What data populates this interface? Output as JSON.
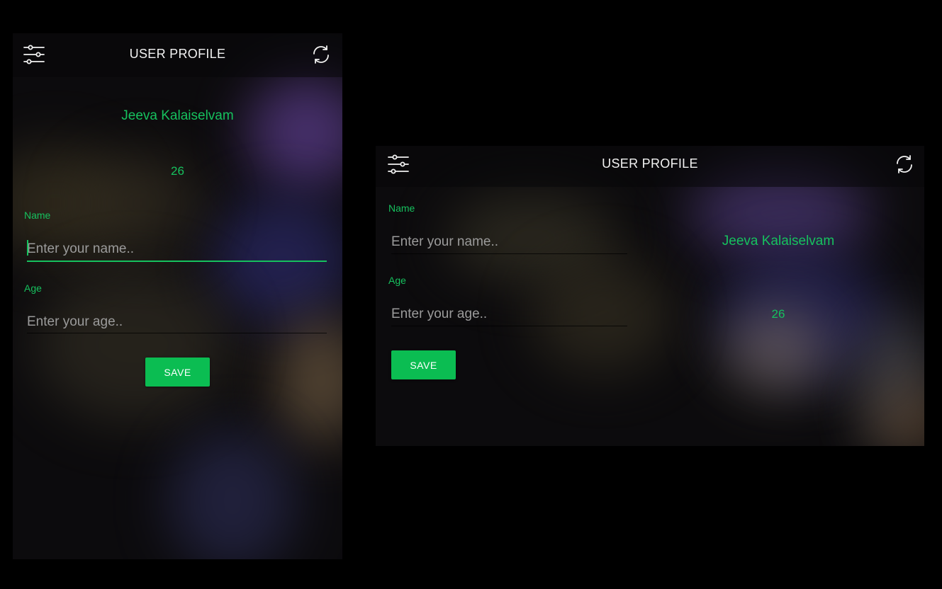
{
  "profile": {
    "title": "USER PROFILE",
    "display_name": "Jeeva Kalaiselvam",
    "display_age": "26",
    "name_label": "Name",
    "name_value": "",
    "name_placeholder": "Enter your name..",
    "age_label": "Age",
    "age_value": "",
    "age_placeholder": "Enter your age..",
    "save_label": "SAVE"
  },
  "icons": {
    "menu": "sliders-icon",
    "refresh": "refresh-icon"
  },
  "colors": {
    "accent": "#16c15e",
    "button": "#0bbd52",
    "background": "#0c0b0d",
    "title_text": "#f2f2f2"
  }
}
